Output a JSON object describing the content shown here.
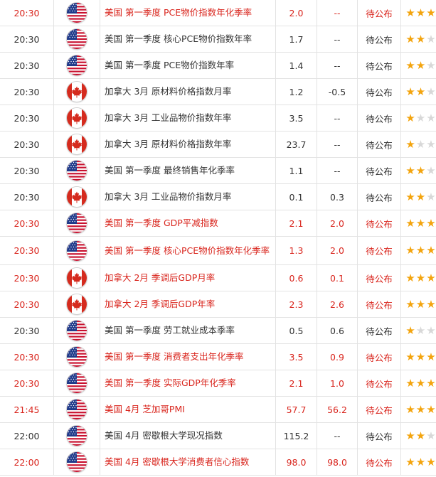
{
  "colors": {
    "highlight": "#d9251d",
    "star_on": "#f3a40e",
    "star_off": "#d8d8d8",
    "border": "#e3e3e3"
  },
  "rows": [
    {
      "time": "20:30",
      "country": "us",
      "event": "美国 第一季度 PCE物价指数年化季率",
      "previous": "2.0",
      "forecast": "--",
      "actual": "待公布",
      "stars": 3,
      "highlight": true
    },
    {
      "time": "20:30",
      "country": "us",
      "event": "美国 第一季度 核心PCE物价指数年率",
      "previous": "1.7",
      "forecast": "--",
      "actual": "待公布",
      "stars": 2,
      "highlight": false
    },
    {
      "time": "20:30",
      "country": "us",
      "event": "美国 第一季度 PCE物价指数年率",
      "previous": "1.4",
      "forecast": "--",
      "actual": "待公布",
      "stars": 2,
      "highlight": false
    },
    {
      "time": "20:30",
      "country": "ca",
      "event": "加拿大 3月 原材料价格指数月率",
      "previous": "1.2",
      "forecast": "-0.5",
      "actual": "待公布",
      "stars": 2,
      "highlight": false
    },
    {
      "time": "20:30",
      "country": "ca",
      "event": "加拿大 3月 工业品物价指数年率",
      "previous": "3.5",
      "forecast": "--",
      "actual": "待公布",
      "stars": 1,
      "highlight": false
    },
    {
      "time": "20:30",
      "country": "ca",
      "event": "加拿大 3月 原材料价格指数年率",
      "previous": "23.7",
      "forecast": "--",
      "actual": "待公布",
      "stars": 1,
      "highlight": false
    },
    {
      "time": "20:30",
      "country": "us",
      "event": "美国 第一季度 最终销售年化季率",
      "previous": "1.1",
      "forecast": "--",
      "actual": "待公布",
      "stars": 2,
      "highlight": false
    },
    {
      "time": "20:30",
      "country": "ca",
      "event": "加拿大 3月 工业品物价指数月率",
      "previous": "0.1",
      "forecast": "0.3",
      "actual": "待公布",
      "stars": 2,
      "highlight": false
    },
    {
      "time": "20:30",
      "country": "us",
      "event": "美国 第一季度 GDP平减指数",
      "previous": "2.1",
      "forecast": "2.0",
      "actual": "待公布",
      "stars": 3,
      "highlight": true
    },
    {
      "time": "20:30",
      "country": "us",
      "event": "美国 第一季度 核心PCE物价指数年化季率",
      "previous": "1.3",
      "forecast": "2.0",
      "actual": "待公布",
      "stars": 3,
      "highlight": true,
      "tall": true
    },
    {
      "time": "20:30",
      "country": "ca",
      "event": "加拿大 2月 季调后GDP月率",
      "previous": "0.6",
      "forecast": "0.1",
      "actual": "待公布",
      "stars": 3,
      "highlight": true
    },
    {
      "time": "20:30",
      "country": "ca",
      "event": "加拿大 2月 季调后GDP年率",
      "previous": "2.3",
      "forecast": "2.6",
      "actual": "待公布",
      "stars": 3,
      "highlight": true
    },
    {
      "time": "20:30",
      "country": "us",
      "event": "美国 第一季度 劳工就业成本季率",
      "previous": "0.5",
      "forecast": "0.6",
      "actual": "待公布",
      "stars": 1,
      "highlight": false
    },
    {
      "time": "20:30",
      "country": "us",
      "event": "美国 第一季度 消费者支出年化季率",
      "previous": "3.5",
      "forecast": "0.9",
      "actual": "待公布",
      "stars": 3,
      "highlight": true
    },
    {
      "time": "20:30",
      "country": "us",
      "event": "美国 第一季度 实际GDP年化季率",
      "previous": "2.1",
      "forecast": "1.0",
      "actual": "待公布",
      "stars": 3,
      "highlight": true
    },
    {
      "time": "21:45",
      "country": "us",
      "event": "美国 4月 芝加哥PMI",
      "previous": "57.7",
      "forecast": "56.2",
      "actual": "待公布",
      "stars": 3,
      "highlight": true
    },
    {
      "time": "22:00",
      "country": "us",
      "event": "美国 4月 密歇根大学现况指数",
      "previous": "115.2",
      "forecast": "--",
      "actual": "待公布",
      "stars": 2,
      "highlight": false
    },
    {
      "time": "22:00",
      "country": "us",
      "event": "美国 4月 密歇根大学消费者信心指数",
      "previous": "98.0",
      "forecast": "98.0",
      "actual": "待公布",
      "stars": 3,
      "highlight": true
    }
  ]
}
